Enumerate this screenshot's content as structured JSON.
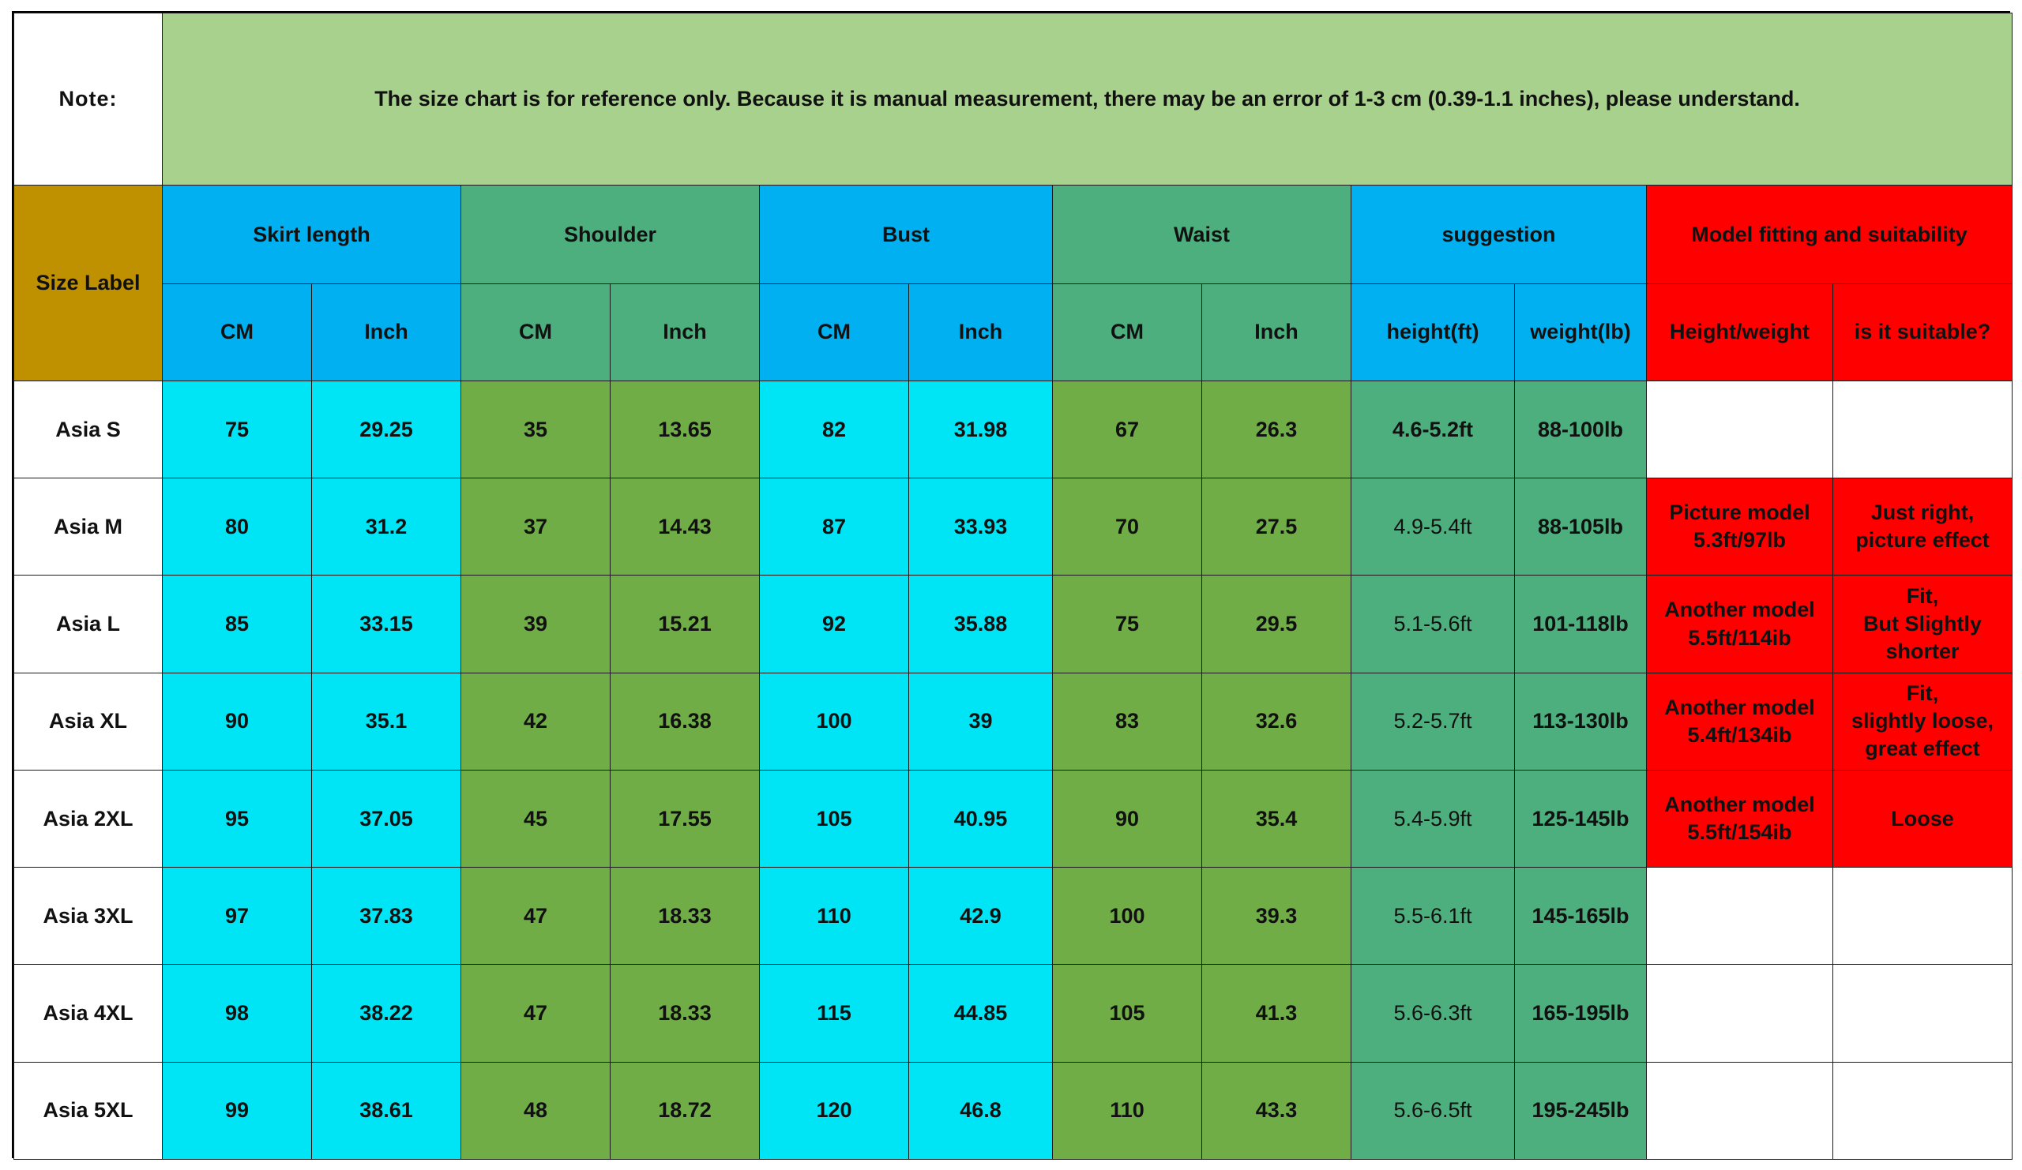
{
  "note": {
    "label": "Note:",
    "text": "The size chart is for reference only. Because it is manual measurement, there may be an error of 1-3 cm (0.39-1.1 inches), please understand."
  },
  "header": {
    "size_label": "Size Label",
    "groups": [
      "Skirt length",
      "Shoulder",
      "Bust",
      "Waist",
      "suggestion",
      "Model fitting and suitability"
    ],
    "subs": [
      "CM",
      "Inch",
      "CM",
      "Inch",
      "CM",
      "Inch",
      "CM",
      "Inch",
      "height(ft)",
      "weight(lb)",
      "Height/weight",
      "is it suitable?"
    ]
  },
  "colors": {
    "note_label": "#ff0000",
    "note_bg": "#a9d18e",
    "size_label_bg": "#bf9000",
    "blue_header": "#00b0f0",
    "green_header": "#4caf7d",
    "red_header": "#ff0000",
    "cyan_cells": "#00e5f5",
    "green_cells": "#70ad47",
    "suggestion_cells": "#4caf7d"
  },
  "rows": [
    {
      "size": "Asia S",
      "v": [
        "75",
        "29.25",
        "35",
        "13.65",
        "82",
        "31.98",
        "67",
        "26.3"
      ],
      "height": "4.6-5.2ft",
      "weight": "88-100lb",
      "model": "",
      "suit": ""
    },
    {
      "size": "Asia M",
      "v": [
        "80",
        "31.2",
        "37",
        "14.43",
        "87",
        "33.93",
        "70",
        "27.5"
      ],
      "height": "4.9-5.4ft",
      "weight": "88-105lb",
      "model": "Picture model\n5.3ft/97lb",
      "suit": "Just right,\npicture effect"
    },
    {
      "size": "Asia L",
      "v": [
        "85",
        "33.15",
        "39",
        "15.21",
        "92",
        "35.88",
        "75",
        "29.5"
      ],
      "height": "5.1-5.6ft",
      "weight": "101-118lb",
      "model": "Another model\n5.5ft/114ib",
      "suit": "Fit,\nBut Slightly\nshorter"
    },
    {
      "size": "Asia XL",
      "v": [
        "90",
        "35.1",
        "42",
        "16.38",
        "100",
        "39",
        "83",
        "32.6"
      ],
      "height": "5.2-5.7ft",
      "weight": "113-130lb",
      "model": "Another model\n5.4ft/134ib",
      "suit": "Fit,\nslightly loose,\ngreat effect"
    },
    {
      "size": "Asia 2XL",
      "v": [
        "95",
        "37.05",
        "45",
        "17.55",
        "105",
        "40.95",
        "90",
        "35.4"
      ],
      "height": "5.4-5.9ft",
      "weight": "125-145lb",
      "model": "Another model\n5.5ft/154ib",
      "suit": "Loose"
    },
    {
      "size": "Asia 3XL",
      "v": [
        "97",
        "37.83",
        "47",
        "18.33",
        "110",
        "42.9",
        "100",
        "39.3"
      ],
      "height": "5.5-6.1ft",
      "weight": "145-165lb",
      "model": "",
      "suit": ""
    },
    {
      "size": "Asia 4XL",
      "v": [
        "98",
        "38.22",
        "47",
        "18.33",
        "115",
        "44.85",
        "105",
        "41.3"
      ],
      "height": "5.6-6.3ft",
      "weight": "165-195lb",
      "model": "",
      "suit": ""
    },
    {
      "size": "Asia 5XL",
      "v": [
        "99",
        "38.61",
        "48",
        "18.72",
        "120",
        "46.8",
        "110",
        "43.3"
      ],
      "height": "5.6-6.5ft",
      "weight": "195-245lb",
      "model": "",
      "suit": ""
    }
  ]
}
